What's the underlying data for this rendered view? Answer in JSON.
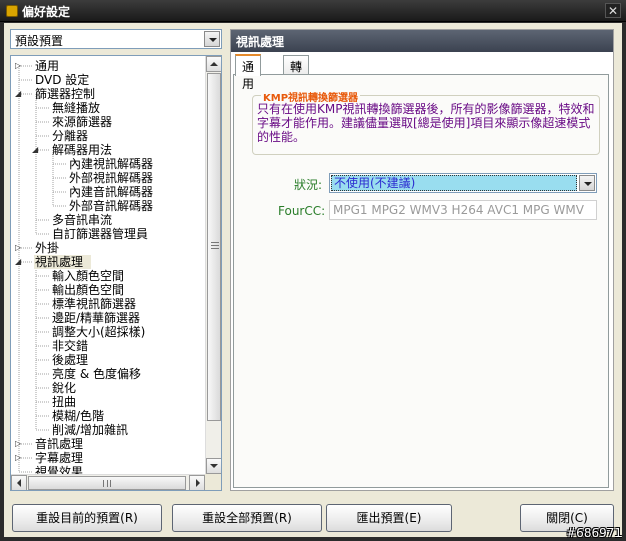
{
  "window": {
    "title": "偏好設定",
    "close_glyph": "✕"
  },
  "preset": {
    "value": "預設預置"
  },
  "tree": {
    "items": [
      {
        "label": "通用",
        "level": 0,
        "expander": "▷"
      },
      {
        "label": "DVD 設定",
        "level": 0,
        "expander": ""
      },
      {
        "label": "篩選器控制",
        "level": 0,
        "expander": "◢"
      },
      {
        "label": "無縫播放",
        "level": 1,
        "expander": ""
      },
      {
        "label": "來源篩選器",
        "level": 1,
        "expander": ""
      },
      {
        "label": "分離器",
        "level": 1,
        "expander": ""
      },
      {
        "label": "解碼器用法",
        "level": 1,
        "expander": "◢"
      },
      {
        "label": "內建視訊解碼器",
        "level": 2,
        "expander": ""
      },
      {
        "label": "外部視訊解碼器",
        "level": 2,
        "expander": ""
      },
      {
        "label": "內建音訊解碼器",
        "level": 2,
        "expander": ""
      },
      {
        "label": "外部音訊解碼器",
        "level": 2,
        "expander": ""
      },
      {
        "label": "多音訊串流",
        "level": 1,
        "expander": ""
      },
      {
        "label": "自訂篩選器管理員",
        "level": 1,
        "expander": ""
      },
      {
        "label": "外掛",
        "level": 0,
        "expander": "▷"
      },
      {
        "label": "視訊處理",
        "level": 0,
        "expander": "◢",
        "selected": true
      },
      {
        "label": "輸入顏色空間",
        "level": 1,
        "expander": ""
      },
      {
        "label": "輸出顏色空間",
        "level": 1,
        "expander": ""
      },
      {
        "label": "標準視訊篩選器",
        "level": 1,
        "expander": ""
      },
      {
        "label": "邊距/精華篩選器",
        "level": 1,
        "expander": ""
      },
      {
        "label": "調整大小(超採樣)",
        "level": 1,
        "expander": ""
      },
      {
        "label": "非交錯",
        "level": 1,
        "expander": ""
      },
      {
        "label": "後處理",
        "level": 1,
        "expander": ""
      },
      {
        "label": "亮度 & 色度偏移",
        "level": 1,
        "expander": ""
      },
      {
        "label": "銳化",
        "level": 1,
        "expander": ""
      },
      {
        "label": "扭曲",
        "level": 1,
        "expander": ""
      },
      {
        "label": "模糊/色階",
        "level": 1,
        "expander": ""
      },
      {
        "label": "削減/增加雜訊",
        "level": 1,
        "expander": ""
      },
      {
        "label": "音訊處理",
        "level": 0,
        "expander": "▷"
      },
      {
        "label": "字幕處理",
        "level": 0,
        "expander": "▷"
      },
      {
        "label": "視覺效果",
        "level": 0,
        "expander": ""
      }
    ]
  },
  "panel": {
    "header": "視訊處理",
    "tabs": [
      {
        "label": "通用",
        "active": true
      },
      {
        "label": "轉譯器",
        "active": false
      }
    ],
    "group_title": "KMP視訊轉換篩選器",
    "description": "只有在使用KMP視訊轉換篩選器後，所有的影像篩選器，特效和字幕才能作用。建議儘量選取[總是使用]項目來顯示像超速模式的性能。",
    "status_label": "狀況:",
    "status_value": "不使用(不建議)",
    "fourcc_label": "FourCC:",
    "fourcc_value": "MPG1 MPG2 WMV3 H264 AVC1 MPG WMV"
  },
  "buttons": {
    "reset_current": "重設目前的預置(R)",
    "reset_all": "重設全部預置(R)",
    "export": "匯出預置(E)",
    "close": "關閉(C)"
  },
  "watermark": "#686971"
}
